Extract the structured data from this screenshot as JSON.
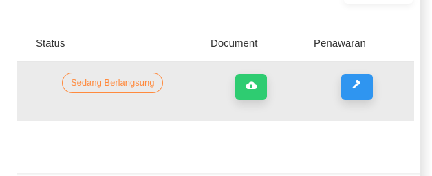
{
  "table": {
    "headers": {
      "status": "Status",
      "document": "Document",
      "offer": "Penawaran"
    },
    "rows": [
      {
        "status": "Sedang Berlangsung",
        "document_icon": "cloud-upload-icon",
        "offer_icon": "gavel-icon"
      }
    ]
  },
  "colors": {
    "status_badge": "#ff8a3d",
    "document_button": "#2ecc71",
    "offer_button": "#2f95f0",
    "row_bg": "#ebebeb"
  }
}
